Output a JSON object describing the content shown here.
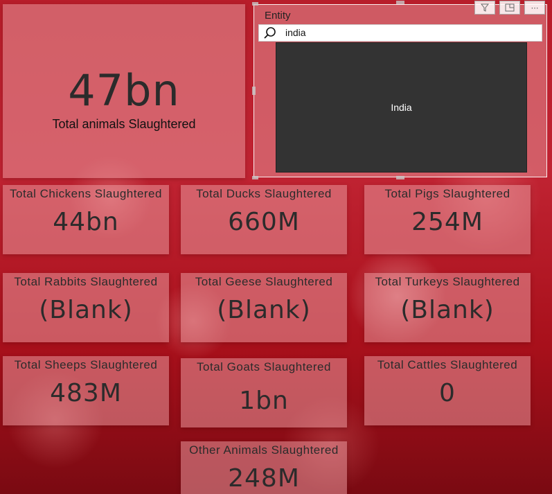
{
  "total": {
    "value": "47bn",
    "label": "Total animals Slaughtered"
  },
  "slicer": {
    "title": "Entity",
    "search_value": "india",
    "items": [
      "India"
    ],
    "toolbar": [
      "filter-icon",
      "focus-mode-icon",
      "more-options-icon"
    ]
  },
  "cards": [
    {
      "label": "Total Chickens Slaughtered",
      "value": "44bn"
    },
    {
      "label": "Total Ducks Slaughtered",
      "value": "660M"
    },
    {
      "label": "Total Pigs Slaughtered",
      "value": "254M"
    },
    {
      "label": "Total Rabbits Slaughtered",
      "value": "(Blank)"
    },
    {
      "label": "Total Geese Slaughtered",
      "value": "(Blank)"
    },
    {
      "label": "Total Turkeys Slaughtered",
      "value": "(Blank)"
    },
    {
      "label": "Total Sheeps Slaughtered",
      "value": "483M"
    },
    {
      "label": "Total Goats Slaughtered",
      "value": "1bn"
    },
    {
      "label": "Total Cattles Slaughtered",
      "value": "0"
    },
    {
      "label": "Other Animals Slaughtered",
      "value": "248M"
    }
  ],
  "colors": {
    "background": "#b81d2a",
    "card": "#e8969b",
    "list_bg": "#333333"
  }
}
